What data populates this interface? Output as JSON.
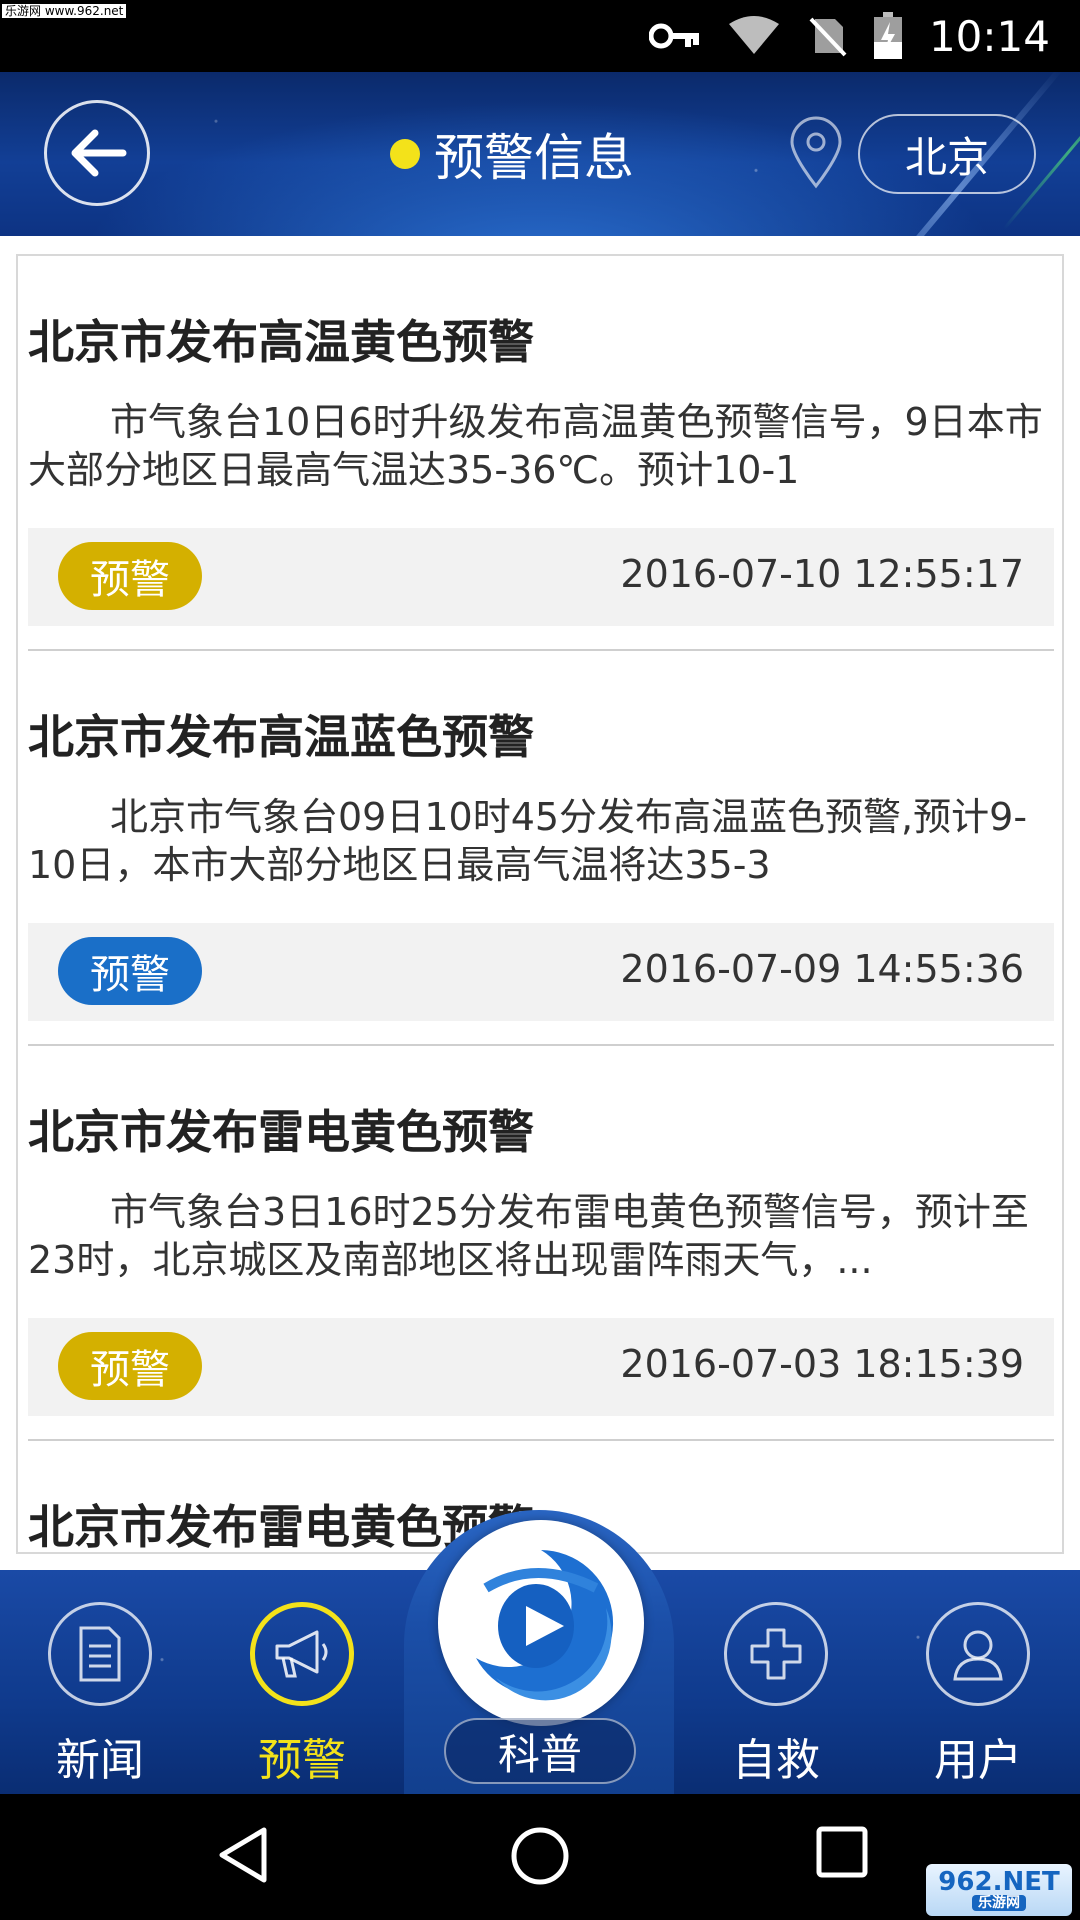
{
  "status_bar": {
    "watermark": "乐游网 www.962.net",
    "time": "10:14",
    "icons": [
      "vpn-key-icon",
      "wifi-icon",
      "no-sim-icon",
      "battery-icon"
    ]
  },
  "header": {
    "title": "预警信息",
    "city": "北京",
    "icons": [
      "back-arrow-icon",
      "location-pin-icon"
    ]
  },
  "alerts": [
    {
      "title": "北京市发布高温黄色预警",
      "body": "市气象台10日6时升级发布高温黄色预警信号，9日本市大部分地区日最高气温达35-36℃。预计10-1",
      "badge": "预警",
      "badge_color": "#d4b000",
      "time": "2016-07-10 12:55:17"
    },
    {
      "title": "北京市发布高温蓝色预警",
      "body": "北京市气象台09日10时45分发布高温蓝色预警,预计9-10日，本市大部分地区日最高气温将达35-3",
      "badge": "预警",
      "badge_color": "#1a6fc8",
      "time": "2016-07-09 14:55:36"
    },
    {
      "title": "北京市发布雷电黄色预警",
      "body": "市气象台3日16时25分发布雷电黄色预警信号，预计至23时，北京城区及南部地区将出现雷阵雨天气，...",
      "badge": "预警",
      "badge_color": "#d4b000",
      "time": "2016-07-03 18:15:39"
    },
    {
      "title": "北京市发布雷电黄色预警",
      "body": "",
      "badge": "",
      "badge_color": "#d4b000",
      "time": ""
    }
  ],
  "bottom_nav": {
    "items": [
      {
        "label": "新闻",
        "icon": "news-document-icon",
        "active": false
      },
      {
        "label": "预警",
        "icon": "megaphone-icon",
        "active": true
      },
      {
        "label": "科普",
        "icon": "app-logo-icon",
        "active": false
      },
      {
        "label": "自救",
        "icon": "medical-cross-icon",
        "active": false
      },
      {
        "label": "用户",
        "icon": "user-icon",
        "active": false
      }
    ],
    "active_color": "#f3e21a"
  },
  "system_nav": {
    "icons": [
      "back-triangle-icon",
      "home-circle-icon",
      "recents-square-icon"
    ]
  },
  "watermark_bottom": {
    "main": "962.NET",
    "sub": "乐游网"
  }
}
